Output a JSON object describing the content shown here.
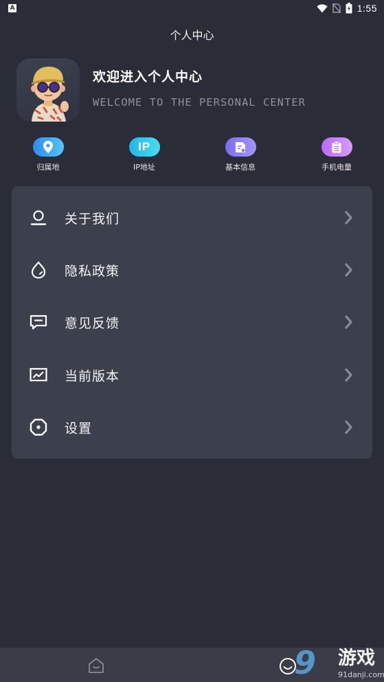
{
  "status_bar": {
    "notification_glyph": "A",
    "time": "1:55",
    "icons": [
      "wifi-icon",
      "no-sim-icon",
      "battery-icon"
    ]
  },
  "header": {
    "title": "个人中心"
  },
  "profile": {
    "welcome_title": "欢迎进入个人中心",
    "welcome_subtitle": "WELCOME TO THE PERSONAL CENTER",
    "avatar_icon": "cartoon-avatar"
  },
  "quick_actions": [
    {
      "label": "归属地",
      "icon": "location-pin-icon",
      "color_from": "#2d8cf0",
      "color_to": "#57c3f5",
      "pill_text": ""
    },
    {
      "label": "IP地址",
      "icon": "ip-icon",
      "color_from": "#25b5e8",
      "color_to": "#47dcf0",
      "pill_text": "IP"
    },
    {
      "label": "基本信息",
      "icon": "info-card-icon",
      "color_from": "#7c6cf0",
      "color_to": "#a594f7",
      "pill_text": ""
    },
    {
      "label": "手机电量",
      "icon": "clipboard-icon",
      "color_from": "#b86cf0",
      "color_to": "#d99bf7",
      "pill_text": ""
    }
  ],
  "menu": [
    {
      "label": "关于我们",
      "icon": "user-icon"
    },
    {
      "label": "隐私政策",
      "icon": "privacy-drop-icon"
    },
    {
      "label": "意见反馈",
      "icon": "feedback-icon"
    },
    {
      "label": "当前版本",
      "icon": "version-chart-icon"
    },
    {
      "label": "设置",
      "icon": "settings-icon"
    }
  ],
  "bottom_nav": {
    "items": [
      "home-icon",
      "profile-smile-icon"
    ]
  },
  "watermark": {
    "logo": "9",
    "text": "游戏",
    "domain": "91danji.com"
  },
  "colors": {
    "background": "#2a2d38",
    "card": "#3c404c",
    "subtitle": "#8e919c"
  }
}
